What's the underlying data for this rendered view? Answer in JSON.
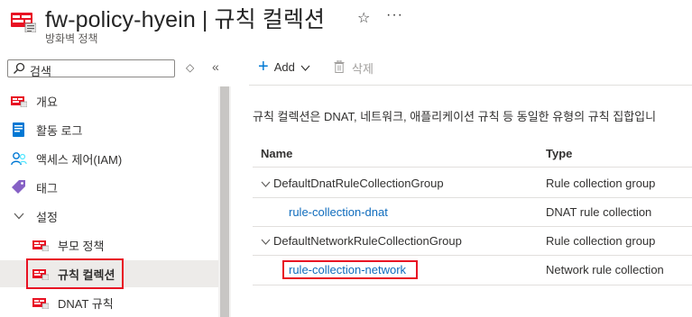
{
  "header": {
    "title": "fw-policy-hyein | 규칙 컬렉션",
    "subtitle": "방화벽 정책",
    "star_icon": "star-icon",
    "more_icon": "more-icon"
  },
  "search": {
    "placeholder": "검색"
  },
  "nav": {
    "items": [
      {
        "label": "개요",
        "icon": "firewall-policy-icon"
      },
      {
        "label": "활동 로그",
        "icon": "activity-log-icon"
      },
      {
        "label": "액세스 제어(IAM)",
        "icon": "iam-icon"
      },
      {
        "label": "태그",
        "icon": "tag-icon"
      },
      {
        "label": "설정",
        "icon": "chevron-down-icon"
      },
      {
        "label": "부모 정책",
        "icon": "firewall-policy-icon"
      },
      {
        "label": "규칙 컬렉션",
        "icon": "firewall-policy-icon"
      },
      {
        "label": "DNAT 규칙",
        "icon": "firewall-policy-icon"
      }
    ]
  },
  "toolbar": {
    "add_label": "Add",
    "delete_label": "삭제"
  },
  "description": "규칙 컬렉션은 DNAT, 네트워크, 애플리케이션 규칙 등 동일한 유형의 규칙 집합입니",
  "table": {
    "headers": {
      "name": "Name",
      "type": "Type"
    },
    "rows": [
      {
        "name": "DefaultDnatRuleCollectionGroup",
        "type": "Rule collection group",
        "kind": "group"
      },
      {
        "name": "rule-collection-dnat",
        "type": "DNAT rule collection",
        "kind": "link"
      },
      {
        "name": "DefaultNetworkRuleCollectionGroup",
        "type": "Rule collection group",
        "kind": "group"
      },
      {
        "name": "rule-collection-network",
        "type": "Network rule collection",
        "kind": "link"
      }
    ]
  },
  "colors": {
    "accent": "#0f6cbd",
    "highlight": "#e81123",
    "firewall": "#e81123"
  }
}
